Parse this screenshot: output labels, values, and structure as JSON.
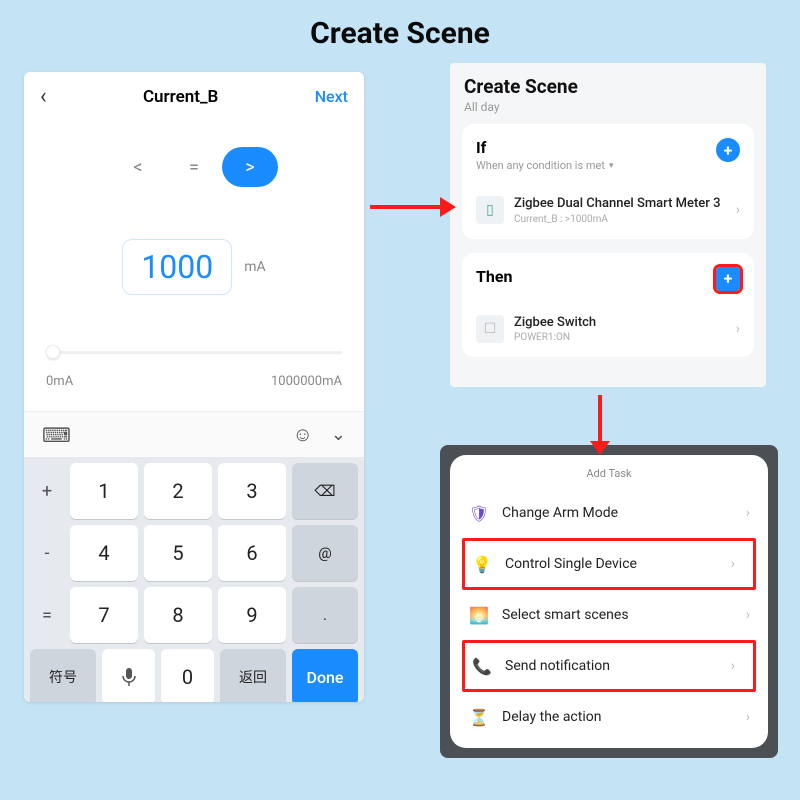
{
  "page_title": "Create Scene",
  "panel1": {
    "title": "Current_B",
    "next": "Next",
    "operators": {
      "lt": "<",
      "eq": "=",
      "gt": ">",
      "active": "gt"
    },
    "value": "1000",
    "unit": "mA",
    "range_min": "0mA",
    "range_max": "1000000mA",
    "keyboard": {
      "row1": {
        "sym": "+",
        "k1": "1",
        "k2": "2",
        "k3": "3",
        "del": "⌫"
      },
      "row2": {
        "sym": "-",
        "k1": "4",
        "k2": "5",
        "k3": "6",
        "at": "@"
      },
      "row3": {
        "sym": "=",
        "k1": "7",
        "k2": "8",
        "k3": "9",
        "dot": "."
      },
      "row4": {
        "sym": "符号",
        "mic": "⌄",
        "k0": "0",
        "ret": "返回",
        "done": "Done"
      }
    }
  },
  "panel2": {
    "title": "Create Scene",
    "subtitle": "All day",
    "if": {
      "label": "If",
      "sub": "When any condition is met",
      "device": "Zigbee Dual Channel Smart Meter 3",
      "device_sub": "Current_B : >1000mA"
    },
    "then": {
      "label": "Then",
      "device": "Zigbee Switch",
      "device_sub": "POWER1:ON"
    }
  },
  "panel3": {
    "title": "Add Task",
    "tasks": {
      "t1": "Change Arm Mode",
      "t2": "Control Single Device",
      "t3": "Select smart scenes",
      "t4": "Send notification",
      "t5": "Delay the action"
    }
  },
  "colors": {
    "accent": "#1a8cff",
    "highlight": "#ff1a1a"
  }
}
